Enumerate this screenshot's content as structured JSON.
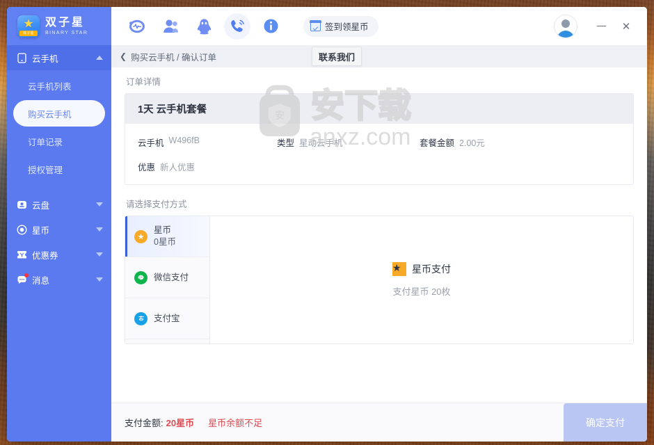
{
  "window": {
    "minimize_label": "—",
    "close_label": "✕",
    "avatar_name": "user-avatar"
  },
  "brand": {
    "name_cn": "双子星",
    "name_en": "BINARY STAR",
    "logo_chip": "双子星"
  },
  "sidebar": {
    "groups": [
      {
        "label": "云手机",
        "icon": "phone-icon",
        "expanded": true,
        "caret": "up",
        "items": [
          {
            "label": "云手机列表",
            "selected": false
          },
          {
            "label": "购买云手机",
            "selected": true
          },
          {
            "label": "订单记录",
            "selected": false
          },
          {
            "label": "授权管理",
            "selected": false
          }
        ]
      },
      {
        "label": "云盘",
        "icon": "cloud-disk-icon",
        "expanded": false,
        "caret": "down",
        "badge": false
      },
      {
        "label": "星币",
        "icon": "star-coin-icon",
        "expanded": false,
        "caret": "down",
        "badge": false
      },
      {
        "label": "优惠券",
        "icon": "coupon-icon",
        "expanded": false,
        "caret": "down",
        "badge": false
      },
      {
        "label": "消息",
        "icon": "message-icon",
        "expanded": false,
        "caret": "down",
        "badge": true
      }
    ]
  },
  "toolbar": {
    "icons": [
      {
        "name": "monitor-icon",
        "glyph": "⊙",
        "highlighted": false
      },
      {
        "name": "contacts-icon",
        "glyph": "👤",
        "highlighted": false
      },
      {
        "name": "qq-penguin-icon",
        "glyph": "🐧",
        "highlighted": false
      },
      {
        "name": "phone-support-icon",
        "glyph": "📞",
        "highlighted": true
      },
      {
        "name": "info-icon",
        "glyph": "i",
        "highlighted": false
      }
    ],
    "signin_label": "签到领星币"
  },
  "breadcrumb": {
    "back_glyph": "❮",
    "text": "购买云手机 / 确认订单",
    "contact_tooltip": "联系我们"
  },
  "order": {
    "section_label": "订单详情",
    "title": "1天 云手机套餐",
    "fields": [
      {
        "key": "云手机",
        "value": "W496fB"
      },
      {
        "key": "类型",
        "value": "星动云手机"
      },
      {
        "key": "套餐金额",
        "value": "2.00元"
      },
      {
        "key": "优惠",
        "value": "新人优惠"
      }
    ]
  },
  "payment": {
    "section_label": "请选择支付方式",
    "options": [
      {
        "name": "星币",
        "sub": "0星币",
        "icon": "star-coin-icon",
        "selected": true
      },
      {
        "name": "微信支付",
        "sub": "",
        "icon": "wechat-pay-icon",
        "selected": false
      },
      {
        "name": "支付宝",
        "sub": "",
        "icon": "alipay-icon",
        "selected": false
      }
    ],
    "detail_title": "星币支付",
    "detail_sub": "支付星币 20枚"
  },
  "footer": {
    "total_label": "支付金额:",
    "total_amount": "20星币",
    "warning": "星币余额不足",
    "confirm_label": "确定支付",
    "confirm_disabled": true
  },
  "watermark": {
    "text_cn": "安下载",
    "text_en": "anxz.com",
    "badge_char": "安"
  },
  "colors": {
    "sidebar_blue": "#5b7af0",
    "accent_blue": "#3b5fd6",
    "coin_orange": "#f7a928",
    "wechat_green": "#10b44c",
    "alipay_blue": "#17a2e8",
    "danger_red": "#e04a52",
    "disabled_button": "#b9c5f2"
  }
}
